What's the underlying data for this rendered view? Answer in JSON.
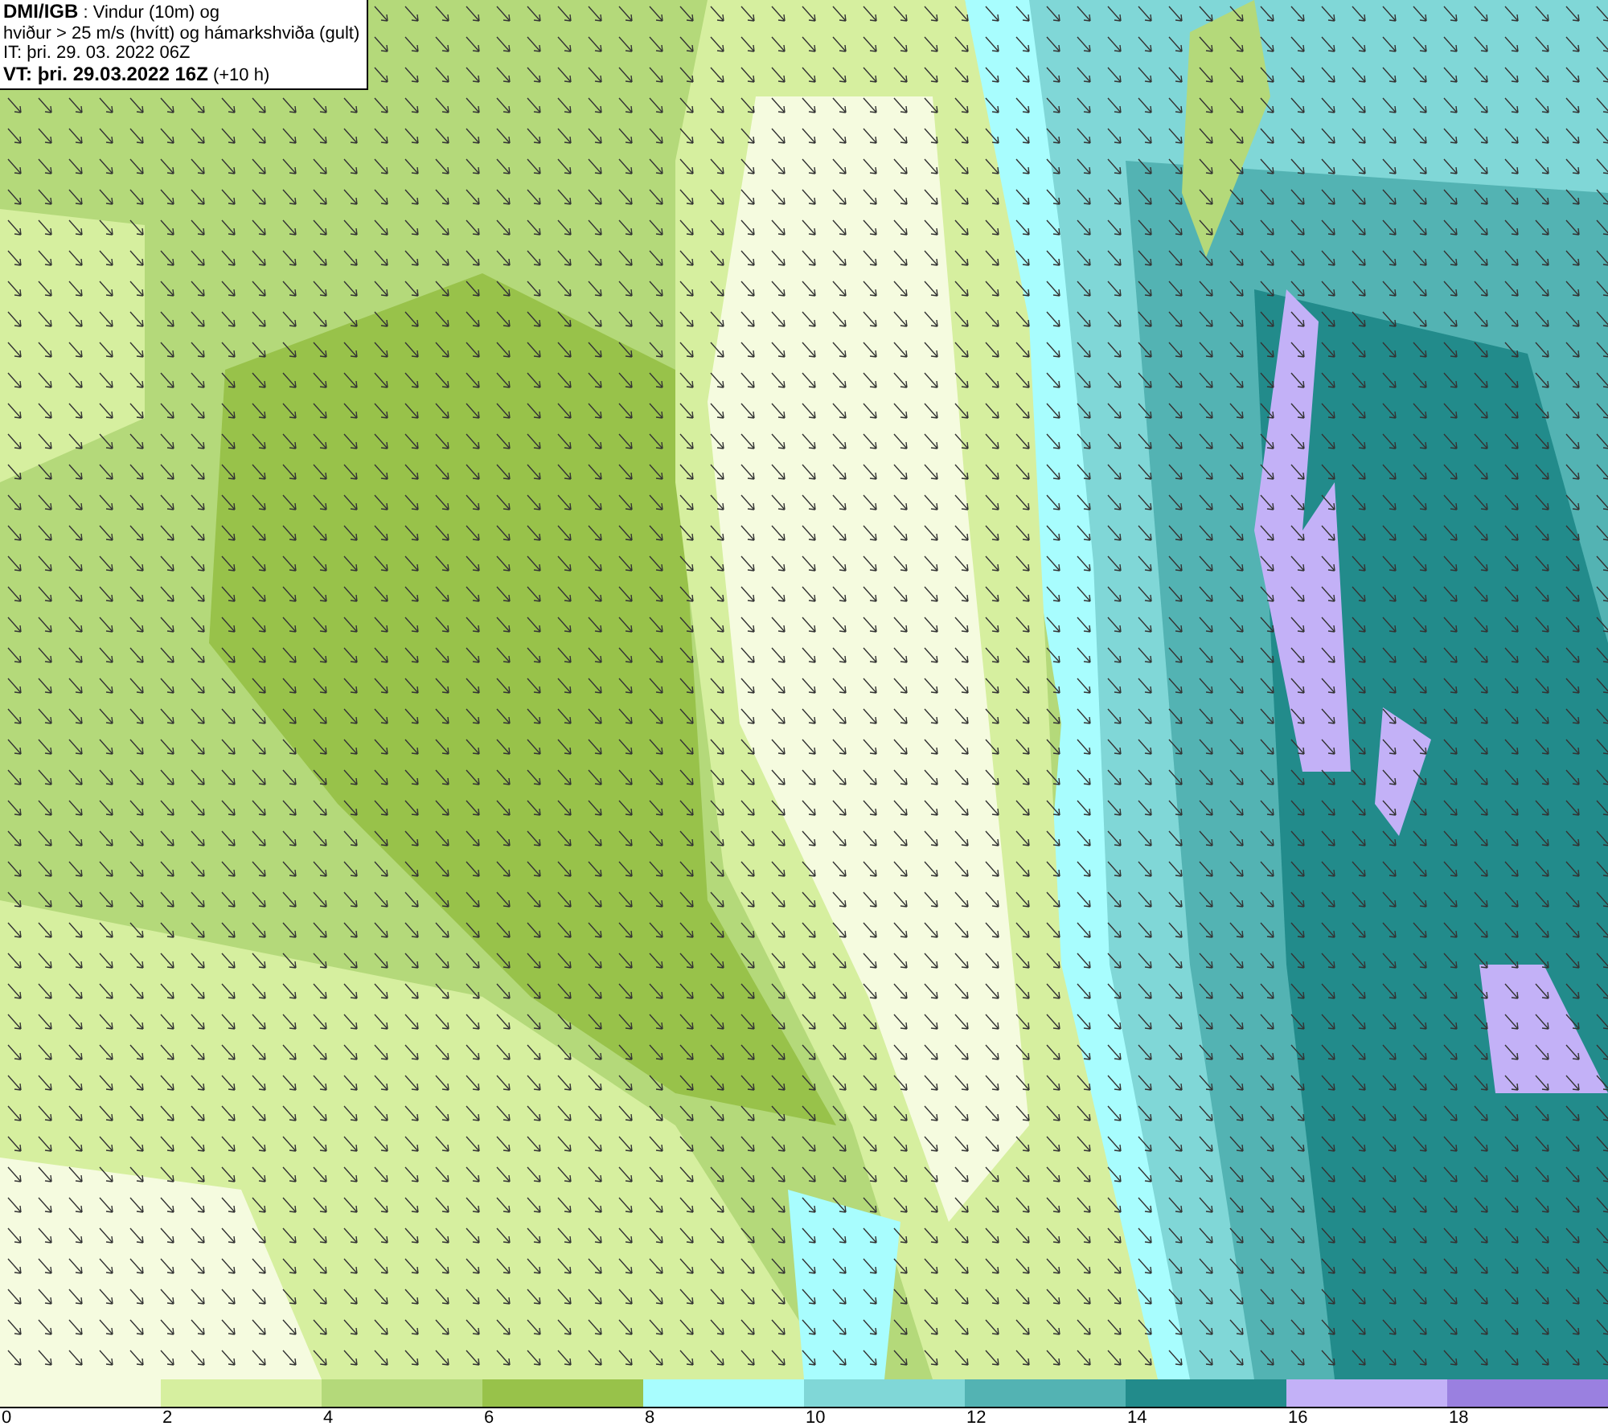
{
  "header": {
    "lines": [
      "**DMI/IGB** : Vindur (10m) og",
      "hviður > 25 m/s (hvítt) og hámarkshviða (gult)",
      "IT: þri. 29. 03. 2022 06Z",
      "**VT: þri. 29.03.2022 16Z** (+10 h)"
    ]
  },
  "legend": {
    "bands": [
      {
        "color": "#f5fbdf"
      },
      {
        "color": "#d6ef9f"
      },
      {
        "color": "#b4d97a"
      },
      {
        "color": "#98c24a"
      },
      {
        "color": "#a8fdfe"
      },
      {
        "color": "#80d7d7"
      },
      {
        "color": "#53b3b3"
      },
      {
        "color": "#228b8b"
      },
      {
        "color": "#c3b1f7"
      },
      {
        "color": "#9a80e0"
      }
    ],
    "ticks": [
      "0",
      "2",
      "4",
      "6",
      "8",
      "10",
      "12",
      "14",
      "16",
      "18"
    ]
  }
}
